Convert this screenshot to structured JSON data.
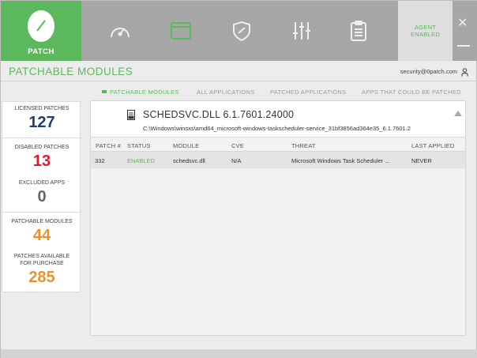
{
  "brand": {
    "label": "PATCH"
  },
  "nav": [
    {
      "name": "dashboard-icon"
    },
    {
      "name": "window-icon",
      "active": true
    },
    {
      "name": "shield-icon"
    },
    {
      "name": "sliders-icon"
    },
    {
      "name": "clipboard-icon"
    }
  ],
  "agent": {
    "line1": "AGENT",
    "line2": "ENABLED"
  },
  "window": {
    "close": "✕"
  },
  "header": {
    "title": "PATCHABLE MODULES",
    "account": "security@0patch.com"
  },
  "tabs": [
    {
      "label": "PATCHABLE MODULES",
      "active": true
    },
    {
      "label": "ALL APPLICATIONS"
    },
    {
      "label": "PATCHED APPLICATIONS"
    },
    {
      "label": "APPS THAT COULD BE PATCHED"
    }
  ],
  "stats": {
    "licensed": {
      "label": "LICENSED PATCHES",
      "value": "127"
    },
    "disabled": {
      "label": "DISABLED PATCHES",
      "value": "13"
    },
    "excluded": {
      "label": "EXCLUDED APPS",
      "value": "0"
    },
    "patchable": {
      "label": "PATCHABLE MODULES",
      "value": "44"
    },
    "available": {
      "label_line1": "PATCHES AVAILABLE",
      "label_line2": "FOR PURCHASE",
      "value": "285"
    }
  },
  "module": {
    "title": "SCHEDSVC.DLL 6.1.7601.24000",
    "path": "C:\\Windows\\winsxs\\amd64_microsoft-windows-taskscheduler-service_31bf3856ad364e35_6.1.7601.2"
  },
  "table": {
    "columns": [
      "PATCH #",
      "STATUS",
      "MODULE",
      "CVE",
      "THREAT",
      "LAST APPLIED"
    ],
    "rows": [
      {
        "patch": "332",
        "status": "ENABLED",
        "module": "schedsvc.dll",
        "cve": "N/A",
        "threat": "Microsoft Windows Task Scheduler ...",
        "last_applied": "NEVER"
      }
    ]
  },
  "colors": {
    "accent": "#5cb85c",
    "danger": "#e0182d",
    "blue": "#1e3f6e",
    "orange": "#e8922e"
  }
}
